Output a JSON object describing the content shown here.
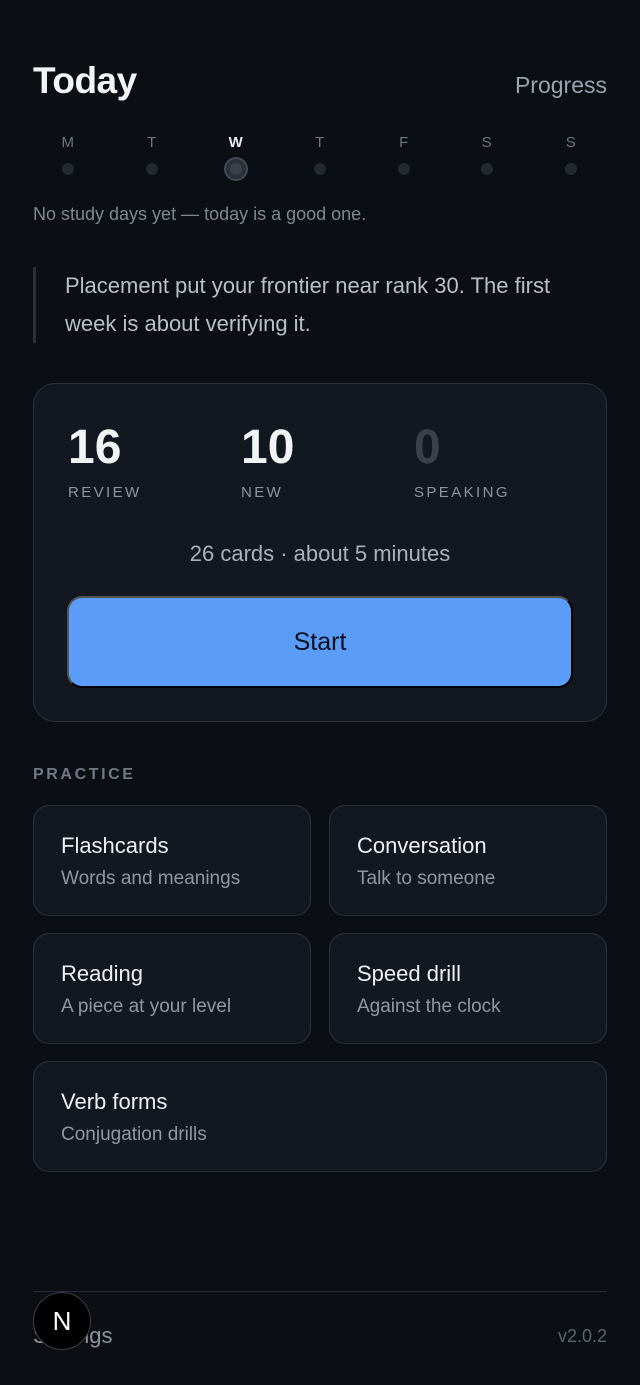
{
  "header": {
    "title": "Today",
    "progress_label": "Progress"
  },
  "week": {
    "days": [
      {
        "letter": "M",
        "today": false
      },
      {
        "letter": "T",
        "today": false
      },
      {
        "letter": "W",
        "today": true
      },
      {
        "letter": "T",
        "today": false
      },
      {
        "letter": "F",
        "today": false
      },
      {
        "letter": "S",
        "today": false
      },
      {
        "letter": "S",
        "today": false
      }
    ],
    "note": "No study days yet — today is a good one."
  },
  "placement_note": "Placement put your frontier near rank 30. The first week is about verifying it.",
  "session": {
    "stats": [
      {
        "value": "16",
        "label": "REVIEW"
      },
      {
        "value": "10",
        "label": "NEW"
      },
      {
        "value": "0",
        "label": "SPEAKING"
      }
    ],
    "summary": "26 cards · about 5 minutes",
    "start_label": "Start"
  },
  "practice": {
    "heading": "PRACTICE",
    "items": [
      {
        "title": "Flashcards",
        "subtitle": "Words and meanings"
      },
      {
        "title": "Conversation",
        "subtitle": "Talk to someone"
      },
      {
        "title": "Reading",
        "subtitle": "A piece at your level"
      },
      {
        "title": "Speed drill",
        "subtitle": "Against the clock"
      },
      {
        "title": "Verb forms",
        "subtitle": "Conjugation drills"
      }
    ]
  },
  "footer": {
    "settings_label": "Settings",
    "version": "v2.0.2"
  },
  "nav_badge": {
    "letter": "N"
  },
  "colors": {
    "accent": "#5b9cf8",
    "background": "#0b0e13",
    "card": "#131820"
  }
}
